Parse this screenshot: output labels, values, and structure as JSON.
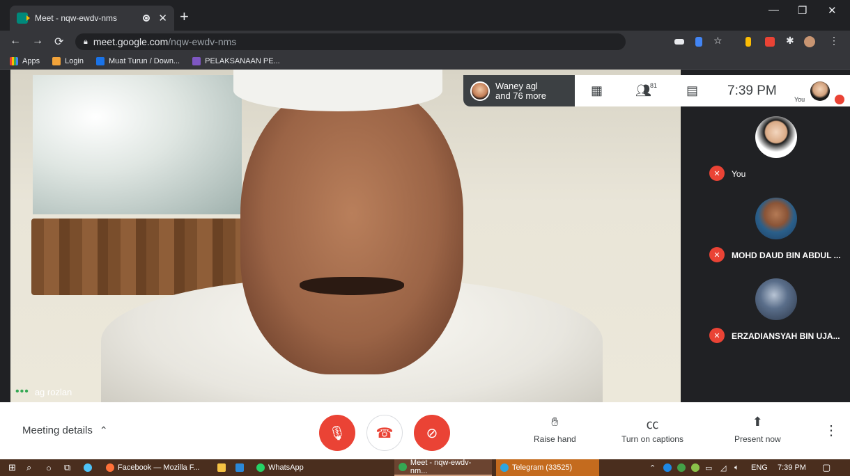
{
  "browser": {
    "tab_title": "Meet - nqw-ewdv-nms",
    "tab_close": "✕",
    "new_tab": "+",
    "address_host": "meet.google.com",
    "address_path": "/nqw-ewdv-nms"
  },
  "bookmarks": [
    {
      "label": "Apps"
    },
    {
      "label": "Login"
    },
    {
      "label": "Muat Turun / Down..."
    },
    {
      "label": "PELAKSANAAN PE..."
    }
  ],
  "meet": {
    "main_speaker": "ag rozlan",
    "top_bar": {
      "presenter_line1": "Waney agl",
      "presenter_line2": "and 76 more",
      "participant_count": "81",
      "time": "7:39 PM",
      "self_label": "You"
    },
    "participants": [
      {
        "name": "You"
      },
      {
        "name": "MOHD DAUD BIN ABDUL ..."
      },
      {
        "name": "ERZADIANSYAH BIN UJA..."
      }
    ],
    "controls": {
      "meeting_details": "Meeting details",
      "raise_hand": "Raise hand",
      "captions": "Turn on captions",
      "present": "Present now"
    }
  },
  "taskbar": {
    "tasks": [
      {
        "label": "Facebook — Mozilla F..."
      },
      {
        "label": "WhatsApp"
      },
      {
        "label": "Meet - nqw-ewdv-nm..."
      },
      {
        "label": "Telegram (33525)"
      }
    ],
    "language": "ENG",
    "clock": "7:39 PM"
  },
  "colors": {
    "meet_red": "#ea4335",
    "background": "#202124",
    "accent_green": "#34a853"
  }
}
